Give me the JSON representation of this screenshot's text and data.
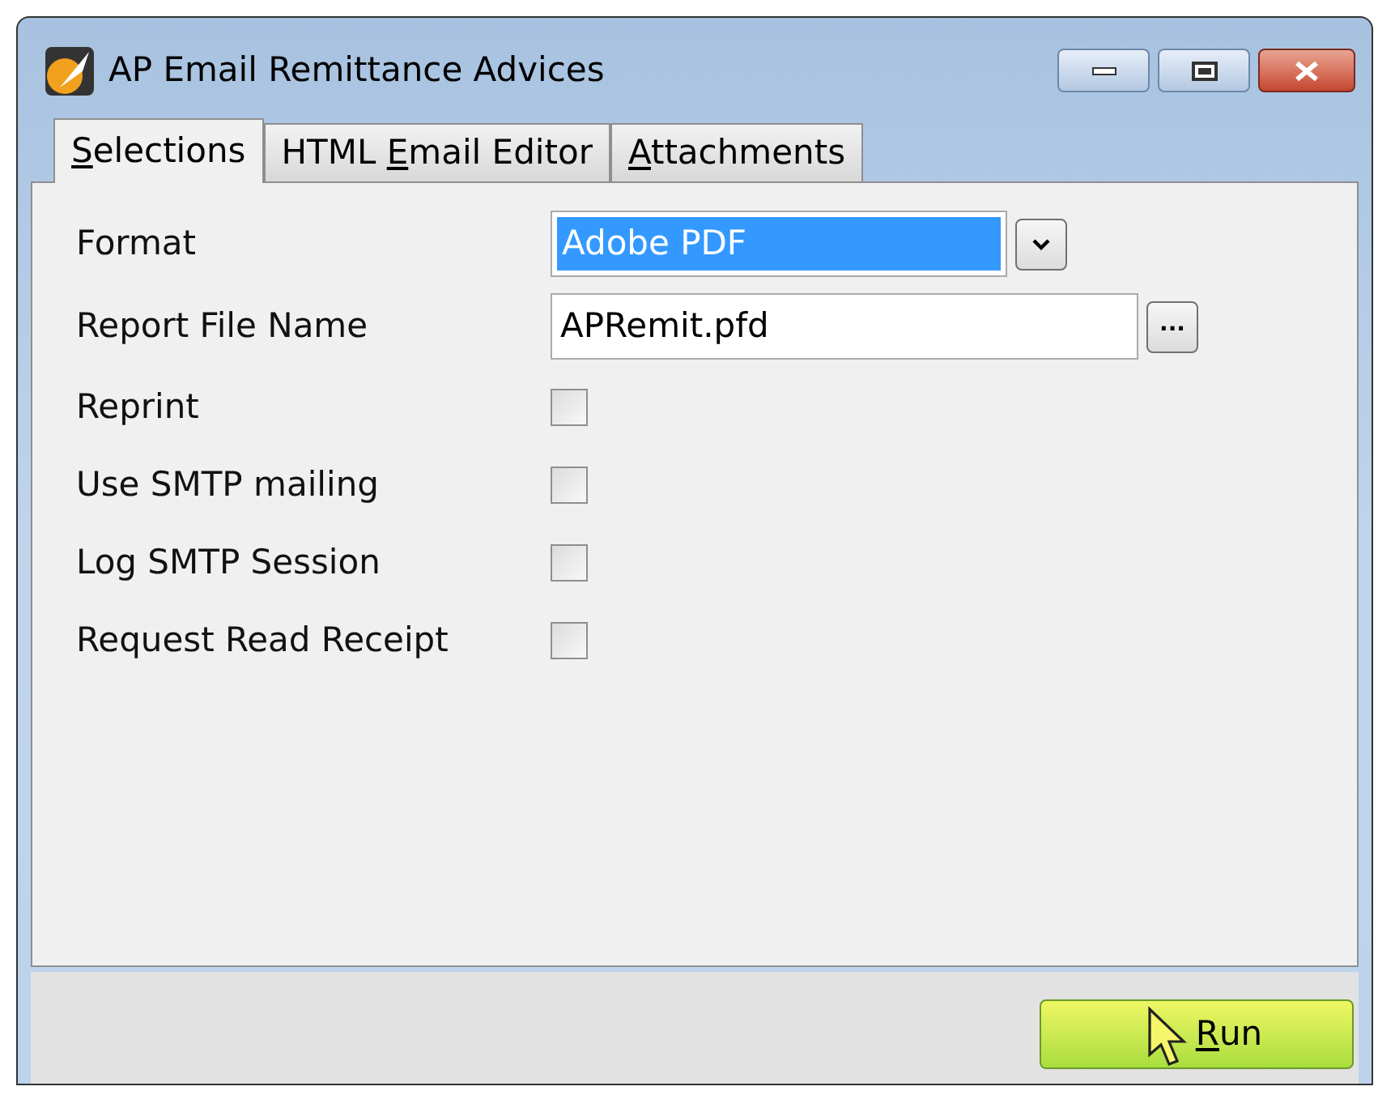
{
  "window": {
    "title": "AP Email Remittance Advices"
  },
  "tabs": [
    {
      "key": "S",
      "after": "elections",
      "selected": true
    },
    {
      "before": "HTML ",
      "key": "E",
      "after": "mail Editor",
      "selected": false
    },
    {
      "key": "A",
      "after": "ttachments",
      "selected": false
    }
  ],
  "fields": [
    {
      "kind": "select",
      "label": "Format",
      "value": "Adobe PDF",
      "selected": true
    },
    {
      "kind": "file",
      "label": "Report File Name",
      "value": "APRemit.pfd",
      "button": "..."
    },
    {
      "kind": "checkbox",
      "label": "Reprint",
      "checked": false
    },
    {
      "kind": "checkbox",
      "label": "Use SMTP mailing",
      "checked": false
    },
    {
      "kind": "checkbox",
      "label": "Log SMTP Session",
      "checked": false
    },
    {
      "kind": "checkbox",
      "label": "Request Read Receipt",
      "checked": false
    }
  ],
  "run_button": {
    "key": "R",
    "after": "un"
  }
}
